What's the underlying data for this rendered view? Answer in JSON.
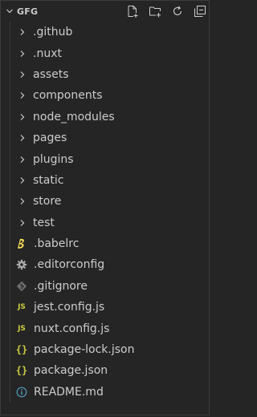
{
  "explorer": {
    "title": "GFG",
    "actions": [
      {
        "name": "new-file-icon"
      },
      {
        "name": "new-folder-icon"
      },
      {
        "name": "refresh-icon"
      },
      {
        "name": "collapse-all-icon"
      }
    ]
  },
  "tree": {
    "folders": [
      {
        "label": ".github"
      },
      {
        "label": ".nuxt"
      },
      {
        "label": "assets"
      },
      {
        "label": "components"
      },
      {
        "label": "node_modules"
      },
      {
        "label": "pages"
      },
      {
        "label": "plugins"
      },
      {
        "label": "static"
      },
      {
        "label": "store"
      },
      {
        "label": "test"
      }
    ],
    "files": [
      {
        "label": ".babelrc",
        "icon": "babel-icon",
        "icon_color": "#f5da55"
      },
      {
        "label": ".editorconfig",
        "icon": "gear-icon",
        "icon_color": "#aaaaaa"
      },
      {
        "label": ".gitignore",
        "icon": "git-icon",
        "icon_color": "#6d6d6d"
      },
      {
        "label": "jest.config.js",
        "icon": "js-icon",
        "icon_glyph": "JS",
        "icon_color": "#cbcb41"
      },
      {
        "label": "nuxt.config.js",
        "icon": "js-icon",
        "icon_glyph": "JS",
        "icon_color": "#cbcb41"
      },
      {
        "label": "package-lock.json",
        "icon": "json-icon",
        "icon_glyph": "{}",
        "icon_color": "#cbcb41"
      },
      {
        "label": "package.json",
        "icon": "json-icon",
        "icon_glyph": "{}",
        "icon_color": "#cbcb41"
      },
      {
        "label": "README.md",
        "icon": "info-icon",
        "icon_color": "#519aba"
      }
    ]
  }
}
